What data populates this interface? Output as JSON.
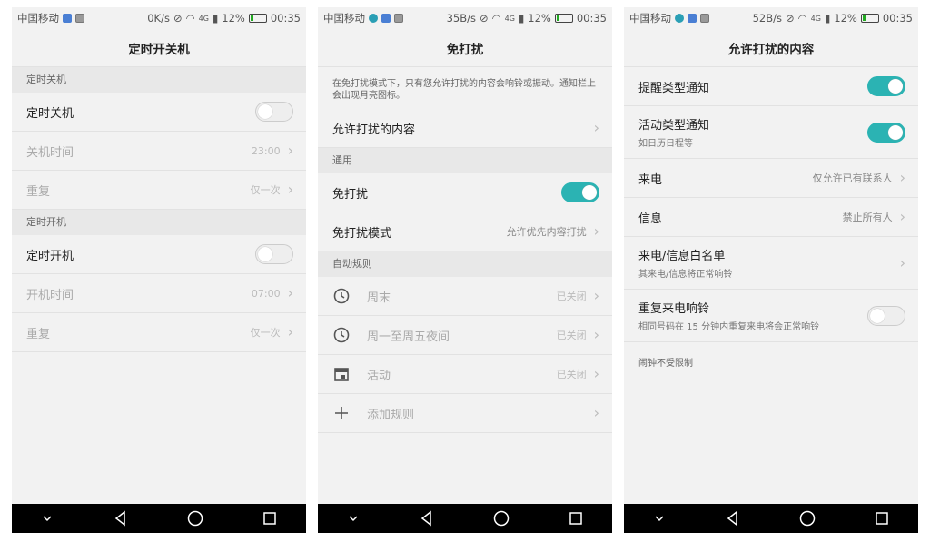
{
  "screens": [
    {
      "status": {
        "carrier": "中国移动",
        "speed": "0K/s",
        "net": "4G",
        "battery": "12%",
        "time": "00:35"
      },
      "title": "定时开关机",
      "sections": [
        {
          "header": "定时关机",
          "rows": [
            {
              "label": "定时关机",
              "toggle": "off"
            },
            {
              "label": "关机时间",
              "value": "23:00"
            },
            {
              "label": "重复",
              "value": "仅一次"
            }
          ]
        },
        {
          "header": "定时开机",
          "rows": [
            {
              "label": "定时开机",
              "toggle": "off"
            },
            {
              "label": "开机时间",
              "value": "07:00"
            },
            {
              "label": "重复",
              "value": "仅一次"
            }
          ]
        }
      ]
    },
    {
      "status": {
        "carrier": "中国移动",
        "speed": "35B/s",
        "net": "4G",
        "battery": "12%",
        "time": "00:35"
      },
      "title": "免打扰",
      "description": "在免打扰模式下，只有您允许打扰的内容会响铃或振动。通知栏上会出现月亮图标。",
      "allowed_row": {
        "label": "允许打扰的内容"
      },
      "general_header": "通用",
      "dnd_row": {
        "label": "免打扰",
        "toggle": "on"
      },
      "mode_row": {
        "label": "免打扰模式",
        "value": "允许优先内容打扰"
      },
      "rules_header": "自动规则",
      "rules": [
        {
          "icon": "clock-icon",
          "label": "周末",
          "value": "已关闭"
        },
        {
          "icon": "clock-icon",
          "label": "周一至周五夜间",
          "value": "已关闭"
        },
        {
          "icon": "calendar-icon",
          "label": "活动",
          "value": "已关闭"
        },
        {
          "icon": "plus-icon",
          "label": "添加规则",
          "value": ""
        }
      ]
    },
    {
      "status": {
        "carrier": "中国移动",
        "speed": "52B/s",
        "net": "4G",
        "battery": "12%",
        "time": "00:35"
      },
      "title": "允许打扰的内容",
      "rows": [
        {
          "label": "提醒类型通知",
          "toggle": "on"
        },
        {
          "label": "活动类型通知",
          "sub": "如日历日程等",
          "toggle": "on"
        },
        {
          "label": "来电",
          "value": "仅允许已有联系人"
        },
        {
          "label": "信息",
          "value": "禁止所有人"
        },
        {
          "label": "来电/信息白名单",
          "sub": "其来电/信息将正常响铃"
        },
        {
          "label": "重复来电响铃",
          "sub": "相同号码在 15 分钟内重复来电将会正常响铃",
          "toggle": "off"
        }
      ],
      "note": "闹钟不受限制"
    }
  ],
  "colors": {
    "accent": "#2bb3b3",
    "background": "#f2f2f2",
    "section": "#e8e8e8",
    "navbar": "#000000"
  }
}
